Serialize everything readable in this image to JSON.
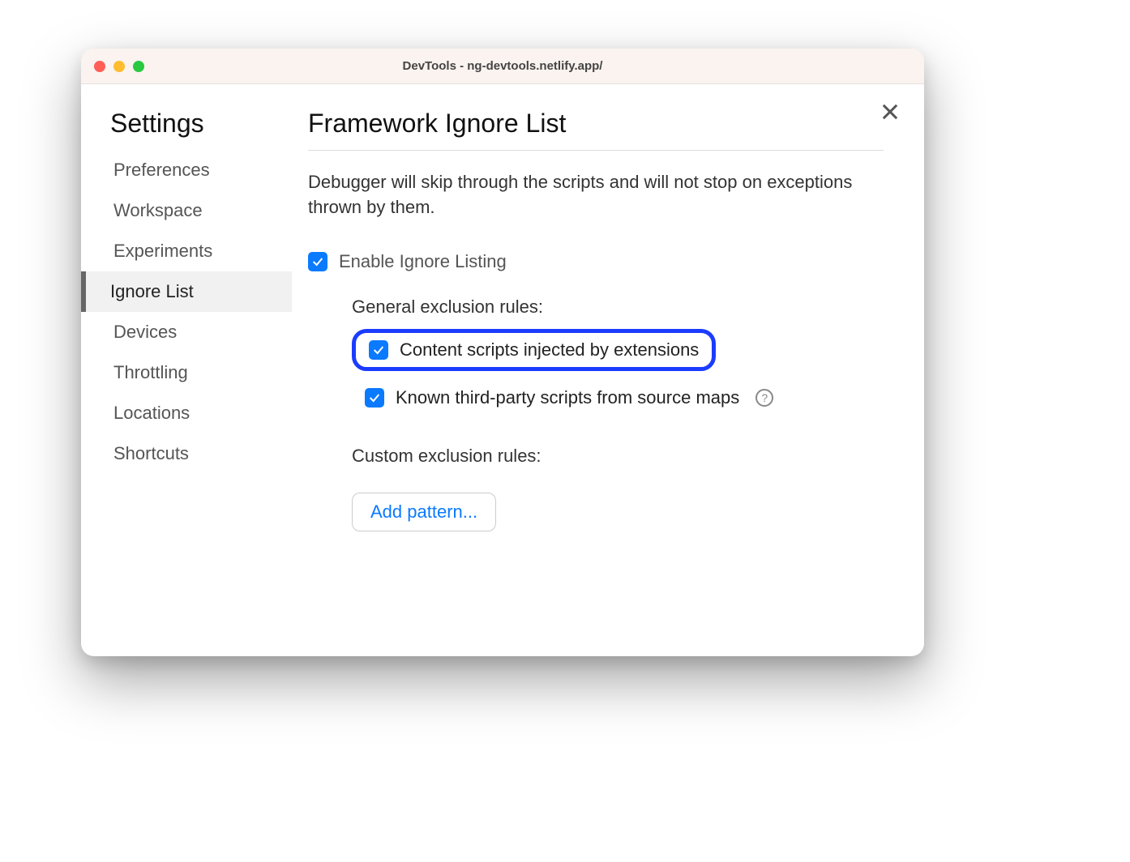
{
  "titlebar": {
    "title": "DevTools - ng-devtools.netlify.app/"
  },
  "sidebar": {
    "title": "Settings",
    "items": [
      {
        "label": "Preferences",
        "active": false
      },
      {
        "label": "Workspace",
        "active": false
      },
      {
        "label": "Experiments",
        "active": false
      },
      {
        "label": "Ignore List",
        "active": true
      },
      {
        "label": "Devices",
        "active": false
      },
      {
        "label": "Throttling",
        "active": false
      },
      {
        "label": "Locations",
        "active": false
      },
      {
        "label": "Shortcuts",
        "active": false
      }
    ]
  },
  "content": {
    "title": "Framework Ignore List",
    "description": "Debugger will skip through the scripts and will not stop on exceptions thrown by them.",
    "enable_label": "Enable Ignore Listing",
    "general_rules_title": "General exclusion rules:",
    "rule_content_scripts": "Content scripts injected by extensions",
    "rule_third_party": "Known third-party scripts from source maps",
    "custom_rules_title": "Custom exclusion rules:",
    "add_pattern_label": "Add pattern..."
  },
  "help_glyph": "?"
}
